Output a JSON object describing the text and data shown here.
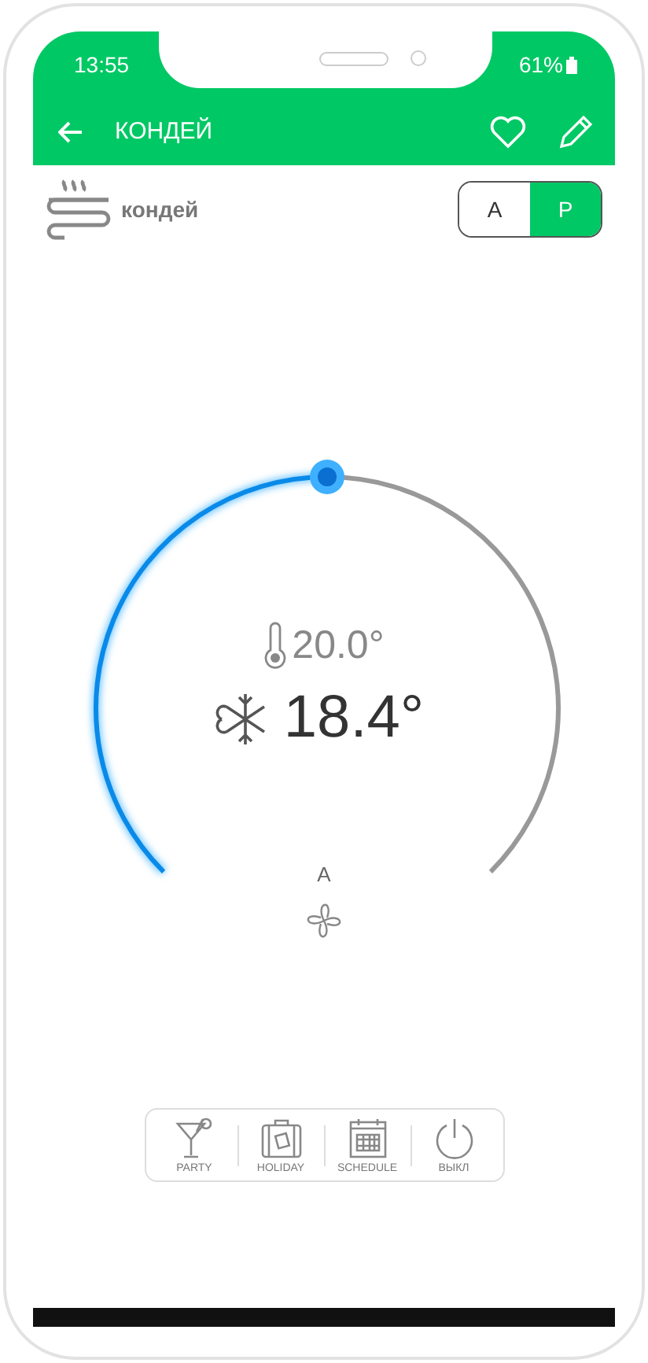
{
  "status_bar": {
    "time": "13:55",
    "battery": "61%"
  },
  "app_bar": {
    "title": "КОНДЕЙ"
  },
  "device": {
    "name": "кондей"
  },
  "mode_toggle": [
    {
      "label": "A",
      "selected": false
    },
    {
      "label": "P",
      "selected": true
    }
  ],
  "dial": {
    "set_temperature": "20.0°",
    "current_temperature": "18.4°",
    "fan_mode": "A"
  },
  "actions": [
    {
      "label": "PARTY",
      "kind": "party"
    },
    {
      "label": "HOLIDAY",
      "kind": "holiday"
    },
    {
      "label": "SCHEDULE",
      "kind": "schedule"
    },
    {
      "label": "ВЫКЛ",
      "kind": "power"
    }
  ]
}
